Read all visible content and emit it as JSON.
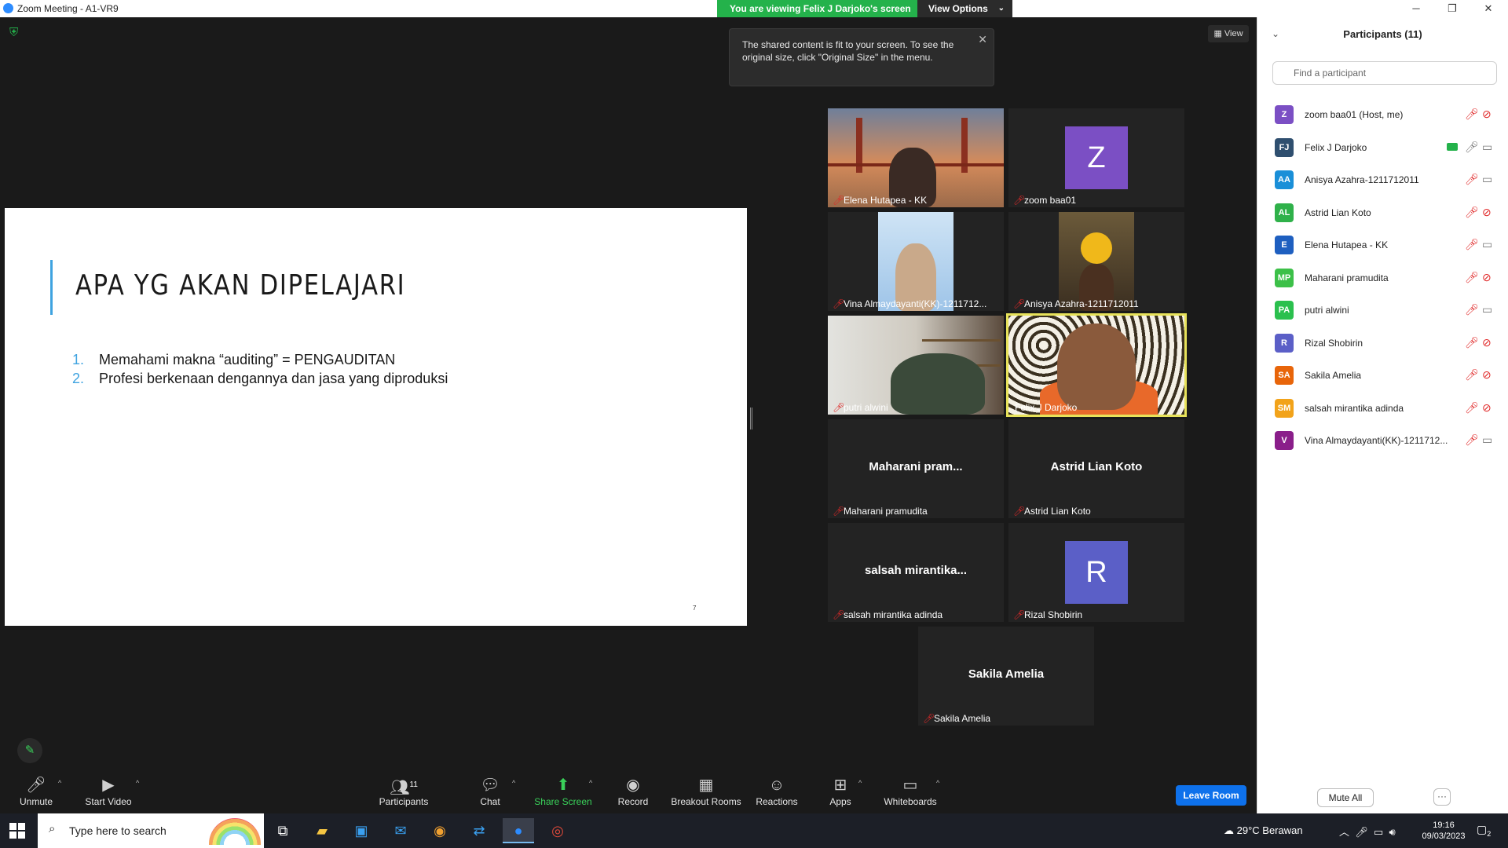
{
  "window": {
    "title": "Zoom Meeting - A1-VR9",
    "minimize": "─",
    "restore": "❐",
    "close": "✕"
  },
  "banner": {
    "viewing_text": "You are viewing Felix J Darjoko's screen",
    "view_options": "View Options"
  },
  "view_button": "View",
  "tooltip": {
    "text": "The shared content is fit to your screen. To see the original size, click \"Original Size\" in the menu."
  },
  "slide": {
    "heading": "APA YG AKAN DIPELAJARI",
    "items": [
      {
        "num": "1.",
        "text": "Memahami makna “auditing” = PENGAUDITAN"
      },
      {
        "num": "2.",
        "text": "Profesi berkenaan dengannya dan jasa yang diproduksi"
      }
    ],
    "page_number": "7"
  },
  "tiles": [
    {
      "name": "Elena Hutapea - KK"
    },
    {
      "name": "zoom baa01",
      "avatar": "Z",
      "avatar_color": "#7b4fc4"
    },
    {
      "name": "Vina Almaydayanti(KK)-1211712..."
    },
    {
      "name": "Anisya Azahra-1211712011"
    },
    {
      "name": "putri alwini"
    },
    {
      "name": "Felix J Darjoko"
    },
    {
      "name": "Maharani pramudita",
      "big": "Maharani  pram..."
    },
    {
      "name": "Astrid Lian Koto",
      "big": "Astrid Lian Koto"
    },
    {
      "name": "salsah mirantika adinda",
      "big": "salsah  mirantika..."
    },
    {
      "name": "Rizal Shobirin",
      "avatar": "R",
      "avatar_color": "#5b5fc7"
    },
    {
      "name": "Sakila Amelia",
      "big": "Sakila Amelia"
    }
  ],
  "toolbar": {
    "unmute": "Unmute",
    "start_video": "Start Video",
    "participants": "Participants",
    "participants_count": "11",
    "chat": "Chat",
    "share_screen": "Share Screen",
    "record": "Record",
    "breakout_rooms": "Breakout Rooms",
    "reactions": "Reactions",
    "apps": "Apps",
    "whiteboards": "Whiteboards",
    "leave_room": "Leave Room"
  },
  "panel": {
    "title": "Participants (11)",
    "search_placeholder": "Find a participant",
    "mute_all": "Mute All",
    "more": "···",
    "participants": [
      {
        "initials": "Z",
        "name": "zoom baa01 (Host, me)",
        "color": "#7b4fc4",
        "mic": "muted",
        "video": "off"
      },
      {
        "initials": "FJ",
        "name": "Felix J Darjoko",
        "color": "#2f4f6f",
        "mic": "on",
        "video": "on",
        "sharing": true
      },
      {
        "initials": "AA",
        "name": "Anisya Azahra-1211712011",
        "color": "#1a8fd8",
        "mic": "muted",
        "video": "on"
      },
      {
        "initials": "AL",
        "name": "Astrid Lian Koto",
        "color": "#2fb14a",
        "mic": "muted",
        "video": "off"
      },
      {
        "initials": "E",
        "name": "Elena Hutapea - KK",
        "color": "#1e5fc0",
        "mic": "muted",
        "video": "on"
      },
      {
        "initials": "MP",
        "name": "Maharani pramudita",
        "color": "#3cc048",
        "mic": "muted",
        "video": "off"
      },
      {
        "initials": "PA",
        "name": "putri alwini",
        "color": "#2bc04e",
        "mic": "muted",
        "video": "on"
      },
      {
        "initials": "R",
        "name": "Rizal Shobirin",
        "color": "#5b5fc7",
        "mic": "muted",
        "video": "off"
      },
      {
        "initials": "SA",
        "name": "Sakila Amelia",
        "color": "#e8650a",
        "mic": "muted",
        "video": "off"
      },
      {
        "initials": "SM",
        "name": "salsah mirantika adinda",
        "color": "#f2a31a",
        "mic": "muted",
        "video": "off"
      },
      {
        "initials": "V",
        "name": "Vina Almaydayanti(KK)-1211712...",
        "color": "#8a1e8a",
        "mic": "muted",
        "video": "on"
      }
    ]
  },
  "taskbar": {
    "search_placeholder": "Type here to search",
    "weather": "29°C  Berawan",
    "time": "19:16",
    "date": "09/03/2023",
    "notification_count": "2"
  }
}
